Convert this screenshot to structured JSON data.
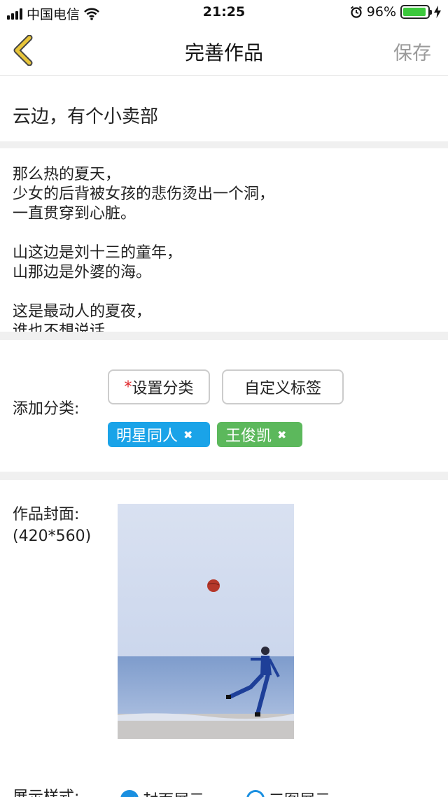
{
  "status_bar": {
    "carrier": "中国电信",
    "time": "21:25",
    "battery_percent": "96%",
    "battery_level": 0.96
  },
  "nav": {
    "title": "完善作品",
    "save_label": "保存"
  },
  "work": {
    "title": "云边，有个小卖部",
    "content_lines": [
      "那么热的夏天，",
      "少女的后背被女孩的悲伤烫出一个洞，",
      "一直贯穿到心脏。",
      "",
      "山这边是刘十三的童年，",
      "山那边是外婆的海。",
      "",
      "这是最动人的夏夜，",
      "谁也不想说话。"
    ]
  },
  "category": {
    "label": "添加分类:",
    "required_mark": "*",
    "set_category_label": "设置分类",
    "custom_tag_label": "自定义标签",
    "tags": [
      {
        "label": "明星同人",
        "color": "#1aa3e8"
      },
      {
        "label": "王俊凯",
        "color": "#5cb85c"
      }
    ]
  },
  "cover": {
    "label_line1": "作品封面:",
    "label_line2": "(420*560)"
  },
  "display_style": {
    "label": "展示样式:",
    "options": [
      {
        "label": "封面展示",
        "selected": true
      },
      {
        "label": "三图展示",
        "selected": false
      }
    ]
  },
  "colors": {
    "accent_blue": "#1a8fe0",
    "required_red": "#e0262b",
    "nav_back": "#e8c53a"
  }
}
